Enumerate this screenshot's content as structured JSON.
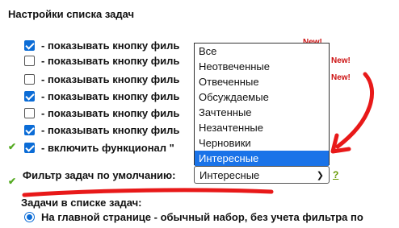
{
  "settings": {
    "title": "Настройки списка задач",
    "rows": [
      {
        "checked": true,
        "text": "- показывать кнопку филь"
      },
      {
        "checked": false,
        "text": "- показывать кнопку филь"
      },
      {
        "checked": false,
        "text": "- показывать кнопку филь"
      },
      {
        "checked": true,
        "text": "- показывать кнопку филь"
      },
      {
        "checked": false,
        "text": "- показывать кнопку филь"
      },
      {
        "checked": true,
        "text": "- показывать кнопку филь"
      },
      {
        "checked": true,
        "text": "- включить функционал \""
      }
    ],
    "new_badges": [
      "New!",
      "New!",
      "New!"
    ]
  },
  "dropdown": {
    "options": [
      "Все",
      "Неотвеченные",
      "Отвеченные",
      "Обсуждаемые",
      "Зачтенные",
      "Незачтенные",
      "Черновики",
      "Интересные"
    ],
    "highlighted_index": 7
  },
  "filter": {
    "label": "Фильтр задач по умолчанию:",
    "selected": "Интересные",
    "help": "?"
  },
  "tasks_section": {
    "label": "Задачи в списке задач:",
    "radio_text": "На главной странице - обычный набор, без учета фильтра по"
  },
  "colors": {
    "accent_blue": "#1a73e8",
    "annotation_red": "#e81919",
    "tick_green": "#55aa22"
  }
}
